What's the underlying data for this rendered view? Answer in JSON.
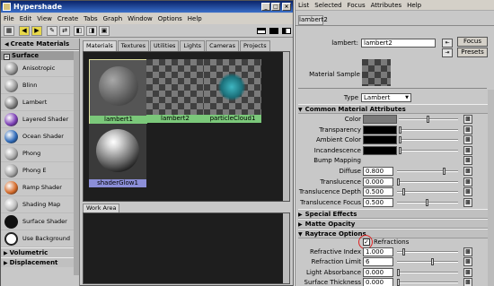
{
  "hypershade": {
    "title": "Hypershade",
    "menu": [
      "File",
      "Edit",
      "View",
      "Create",
      "Tabs",
      "Graph",
      "Window",
      "Options",
      "Help"
    ],
    "create_panel": {
      "title": "Create Materials",
      "surface_section": "Surface",
      "materials": [
        {
          "label": "Anisotropic",
          "color": "#8f8f8f"
        },
        {
          "label": "Blinn",
          "color": "#9a9a9a"
        },
        {
          "label": "Lambert",
          "color": "#7a7a7a"
        },
        {
          "label": "Layered Shader",
          "color": "#7c3fb5"
        },
        {
          "label": "Ocean Shader",
          "color": "#2f6ab8"
        },
        {
          "label": "Phong",
          "color": "#a5a5a5"
        },
        {
          "label": "Phong E",
          "color": "#9e9e9e"
        },
        {
          "label": "Ramp Shader",
          "color": "#d56b2a"
        },
        {
          "label": "Shading Map",
          "color": "#bcbcbc"
        },
        {
          "label": "Surface Shader",
          "color": "#111111"
        },
        {
          "label": "Use Background",
          "color": "#e0e0e0"
        }
      ],
      "volumetric_section": "Volumetric",
      "displacement_section": "Displacement"
    },
    "material_tabs": [
      "Materials",
      "Textures",
      "Utilities",
      "Lights",
      "Cameras",
      "Projects"
    ],
    "nodes": [
      "lambert1",
      "lambert2",
      "particleCloud1",
      "shaderGlow1"
    ],
    "work_area_tab": "Work Area"
  },
  "attribute_editor": {
    "menu": [
      "List",
      "Selected",
      "Focus",
      "Attributes",
      "Help"
    ],
    "tab": "lambert2",
    "node_label": "lambert:",
    "node_value": "lambert2",
    "focus_button": "Focus",
    "presets_button": "Presets",
    "sample_label": "Material Sample",
    "type_label": "Type",
    "type_value": "Lambert",
    "common_section": "Common Material Attributes",
    "attributes": [
      {
        "label": "Color",
        "kind": "color",
        "swatch": "#7a7a7a",
        "level": 0.5
      },
      {
        "label": "Transparency",
        "kind": "color",
        "swatch": "#000000",
        "level": 0.0
      },
      {
        "label": "Ambient Color",
        "kind": "color",
        "swatch": "#000000",
        "level": 0.0
      },
      {
        "label": "Incandescence",
        "kind": "color",
        "swatch": "#000000",
        "level": 0.0
      },
      {
        "label": "Bump Mapping",
        "kind": "map"
      },
      {
        "label": "Diffuse",
        "kind": "value",
        "value": "0.800",
        "level": 0.8
      },
      {
        "label": "Translucence",
        "kind": "value",
        "value": "0.000",
        "level": 0.0
      },
      {
        "label": "Translucence Depth",
        "kind": "value",
        "value": "0.500",
        "level": 0.1
      },
      {
        "label": "Translucence Focus",
        "kind": "value",
        "value": "0.500",
        "level": 0.5
      }
    ],
    "special_effects_section": "Special Effects",
    "matte_opacity_section": "Matte Opacity",
    "raytrace_section": "Raytrace Options",
    "refractions_label": "Refractions",
    "refractions_checked": true,
    "raytrace_attributes": [
      {
        "label": "Refractive Index",
        "value": "1.000",
        "level": 0.1
      },
      {
        "label": "Refraction Limit",
        "value": "6",
        "level": 0.6
      },
      {
        "label": "Light Absorbance",
        "value": "0.000",
        "level": 0.0
      },
      {
        "label": "Surface Thickness",
        "value": "0.000",
        "level": 0.0
      }
    ]
  }
}
